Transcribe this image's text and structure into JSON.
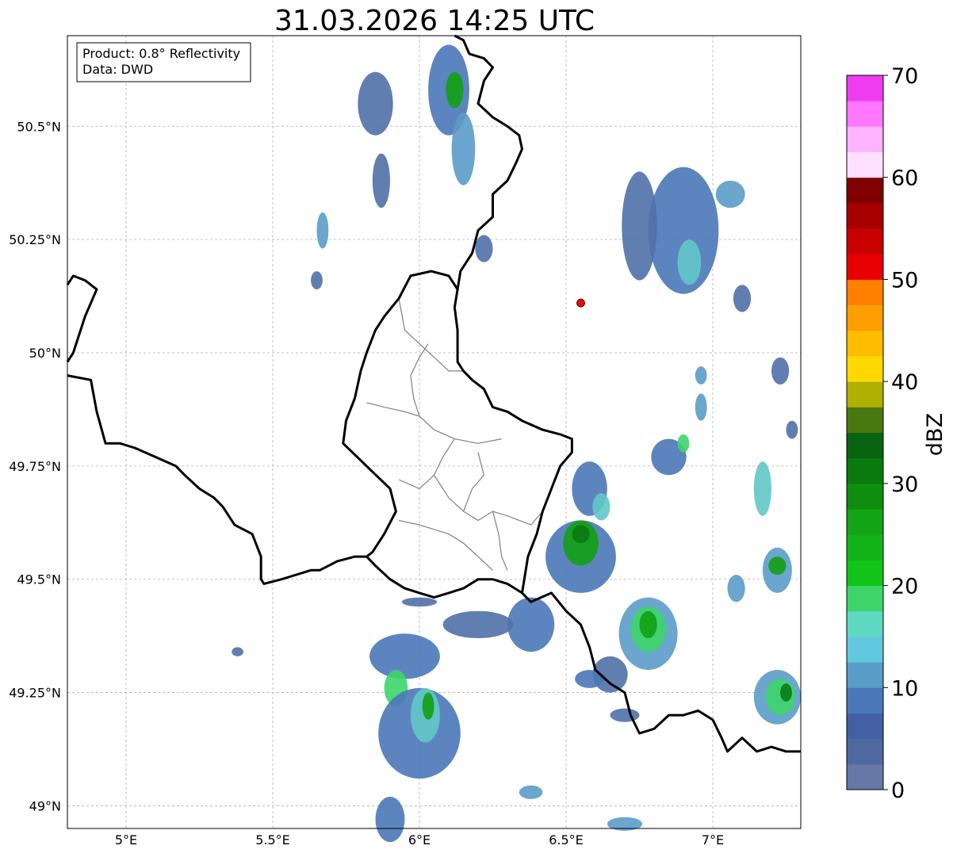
{
  "title": "31.03.2026 14:25 UTC",
  "info_box": {
    "product": "Product: 0.8° Reflectivity",
    "data": "Data: DWD"
  },
  "map": {
    "projection": "plate-carree",
    "lon_range": [
      4.8,
      7.3
    ],
    "lat_range": [
      48.95,
      50.7
    ],
    "lon_ticks": [
      {
        "value": 5.0,
        "label": "5°E"
      },
      {
        "value": 5.5,
        "label": "5.5°E"
      },
      {
        "value": 6.0,
        "label": "6°E"
      },
      {
        "value": 6.5,
        "label": "6.5°E"
      },
      {
        "value": 7.0,
        "label": "7°E"
      }
    ],
    "lat_ticks": [
      {
        "value": 50.5,
        "label": "50.5°N"
      },
      {
        "value": 50.25,
        "label": "50.25°N"
      },
      {
        "value": 50.0,
        "label": "50°N"
      },
      {
        "value": 49.75,
        "label": "49.75°N"
      },
      {
        "value": 49.5,
        "label": "49.5°N"
      },
      {
        "value": 49.25,
        "label": "49.25°N"
      },
      {
        "value": 49.0,
        "label": "49°N"
      }
    ],
    "gridlines": true,
    "radar_site": {
      "lon": 6.55,
      "lat": 50.11,
      "color": "#ff0000"
    },
    "borders": [
      [
        [
          4.8,
          50.15
        ],
        [
          4.82,
          50.17
        ],
        [
          4.86,
          50.16
        ],
        [
          4.9,
          50.14
        ],
        [
          4.86,
          50.08
        ],
        [
          4.84,
          50.04
        ],
        [
          4.82,
          50.0
        ],
        [
          4.8,
          49.98
        ]
      ],
      [
        [
          4.8,
          49.95
        ],
        [
          4.88,
          49.94
        ],
        [
          4.9,
          49.87
        ],
        [
          4.93,
          49.8
        ],
        [
          4.98,
          49.8
        ],
        [
          5.03,
          49.79
        ],
        [
          5.1,
          49.77
        ],
        [
          5.17,
          49.75
        ],
        [
          5.2,
          49.73
        ],
        [
          5.25,
          49.7
        ],
        [
          5.3,
          49.68
        ],
        [
          5.33,
          49.66
        ],
        [
          5.37,
          49.62
        ],
        [
          5.43,
          49.6
        ],
        [
          5.46,
          49.55
        ],
        [
          5.46,
          49.5
        ],
        [
          5.47,
          49.49
        ],
        [
          5.53,
          49.5
        ],
        [
          5.58,
          49.51
        ],
        [
          5.63,
          49.52
        ],
        [
          5.66,
          49.52
        ],
        [
          5.72,
          49.54
        ],
        [
          5.78,
          49.55
        ],
        [
          5.82,
          49.55
        ],
        [
          5.85,
          49.53
        ],
        [
          5.9,
          49.5
        ],
        [
          5.95,
          49.48
        ],
        [
          6.0,
          49.47
        ],
        [
          6.05,
          49.46
        ],
        [
          6.1,
          49.47
        ],
        [
          6.15,
          49.48
        ],
        [
          6.2,
          49.5
        ],
        [
          6.25,
          49.5
        ],
        [
          6.3,
          49.49
        ],
        [
          6.35,
          49.47
        ],
        [
          6.38,
          49.45
        ],
        [
          6.45,
          49.47
        ],
        [
          6.5,
          49.43
        ],
        [
          6.55,
          49.4
        ],
        [
          6.58,
          49.35
        ],
        [
          6.6,
          49.3
        ],
        [
          6.65,
          49.27
        ],
        [
          6.7,
          49.25
        ],
        [
          6.72,
          49.2
        ],
        [
          6.75,
          49.16
        ],
        [
          6.8,
          49.17
        ],
        [
          6.85,
          49.2
        ],
        [
          6.9,
          49.2
        ],
        [
          6.95,
          49.21
        ],
        [
          7.0,
          49.19
        ],
        [
          7.03,
          49.15
        ],
        [
          7.05,
          49.12
        ],
        [
          7.1,
          49.15
        ],
        [
          7.15,
          49.12
        ],
        [
          7.2,
          49.13
        ],
        [
          7.25,
          49.12
        ],
        [
          7.3,
          49.12
        ]
      ],
      [
        [
          6.35,
          49.47
        ],
        [
          6.37,
          49.55
        ],
        [
          6.4,
          49.6
        ],
        [
          6.42,
          49.65
        ],
        [
          6.45,
          49.7
        ],
        [
          6.48,
          49.75
        ],
        [
          6.52,
          49.78
        ],
        [
          6.52,
          49.81
        ],
        [
          6.48,
          49.82
        ],
        [
          6.42,
          49.83
        ],
        [
          6.35,
          49.85
        ],
        [
          6.3,
          49.87
        ],
        [
          6.25,
          49.88
        ],
        [
          6.22,
          49.92
        ],
        [
          6.18,
          49.94
        ],
        [
          6.15,
          49.96
        ],
        [
          6.13,
          49.98
        ],
        [
          6.13,
          50.05
        ],
        [
          6.12,
          50.1
        ],
        [
          6.13,
          50.14
        ],
        [
          6.14,
          50.18
        ],
        [
          6.18,
          50.22
        ],
        [
          6.2,
          50.27
        ],
        [
          6.25,
          50.3
        ],
        [
          6.25,
          50.35
        ],
        [
          6.3,
          50.38
        ],
        [
          6.33,
          50.42
        ],
        [
          6.35,
          50.45
        ],
        [
          6.34,
          50.48
        ],
        [
          6.3,
          50.5
        ],
        [
          6.25,
          50.52
        ],
        [
          6.2,
          50.55
        ],
        [
          6.22,
          50.6
        ],
        [
          6.25,
          50.63
        ],
        [
          6.22,
          50.65
        ],
        [
          6.17,
          50.66
        ],
        [
          6.15,
          50.69
        ],
        [
          6.12,
          50.7
        ]
      ],
      [
        [
          6.13,
          50.14
        ],
        [
          6.1,
          50.17
        ],
        [
          6.04,
          50.18
        ],
        [
          5.97,
          50.17
        ],
        [
          5.93,
          50.12
        ],
        [
          5.88,
          50.08
        ],
        [
          5.85,
          50.05
        ],
        [
          5.82,
          50.0
        ],
        [
          5.8,
          49.96
        ],
        [
          5.78,
          49.9
        ],
        [
          5.75,
          49.85
        ],
        [
          5.74,
          49.8
        ],
        [
          5.82,
          49.75
        ],
        [
          5.9,
          49.7
        ],
        [
          5.92,
          49.65
        ],
        [
          5.88,
          49.6
        ],
        [
          5.84,
          49.56
        ],
        [
          5.82,
          49.55
        ]
      ]
    ],
    "districts": [
      [
        [
          5.82,
          49.89
        ],
        [
          5.88,
          49.88
        ],
        [
          5.95,
          49.87
        ],
        [
          6.0,
          49.86
        ]
      ],
      [
        [
          6.0,
          49.86
        ],
        [
          6.05,
          49.83
        ],
        [
          6.12,
          49.81
        ],
        [
          6.2,
          49.8
        ],
        [
          6.28,
          49.81
        ]
      ],
      [
        [
          6.0,
          49.86
        ],
        [
          5.98,
          49.9
        ],
        [
          5.97,
          49.95
        ],
        [
          6.0,
          49.99
        ],
        [
          6.03,
          50.02
        ]
      ],
      [
        [
          5.93,
          50.12
        ],
        [
          5.95,
          50.05
        ],
        [
          6.0,
          50.02
        ],
        [
          6.05,
          49.99
        ],
        [
          6.1,
          49.96
        ],
        [
          6.15,
          49.96
        ]
      ],
      [
        [
          6.12,
          49.81
        ],
        [
          6.08,
          49.77
        ],
        [
          6.05,
          49.73
        ],
        [
          6.1,
          49.68
        ],
        [
          6.15,
          49.65
        ],
        [
          6.2,
          49.63
        ],
        [
          6.25,
          49.65
        ],
        [
          6.3,
          49.64
        ]
      ],
      [
        [
          6.3,
          49.64
        ],
        [
          6.38,
          49.62
        ],
        [
          6.42,
          49.65
        ]
      ],
      [
        [
          5.93,
          49.72
        ],
        [
          6.0,
          49.7
        ],
        [
          6.05,
          49.73
        ]
      ],
      [
        [
          5.93,
          49.63
        ],
        [
          6.0,
          49.62
        ],
        [
          6.1,
          49.6
        ],
        [
          6.15,
          49.58
        ],
        [
          6.2,
          49.55
        ],
        [
          6.25,
          49.52
        ]
      ],
      [
        [
          6.25,
          49.65
        ],
        [
          6.27,
          49.6
        ],
        [
          6.28,
          49.55
        ],
        [
          6.3,
          49.52
        ]
      ],
      [
        [
          6.2,
          49.78
        ],
        [
          6.22,
          49.73
        ],
        [
          6.18,
          49.7
        ],
        [
          6.15,
          49.65
        ]
      ]
    ],
    "echoes": [
      {
        "lon": 5.85,
        "lat": 50.55,
        "rx": 0.06,
        "ry": 0.07,
        "c": "#5070a8"
      },
      {
        "lon": 6.1,
        "lat": 50.58,
        "rx": 0.07,
        "ry": 0.1,
        "c": "#4a78b8"
      },
      {
        "lon": 6.12,
        "lat": 50.58,
        "rx": 0.03,
        "ry": 0.04,
        "c": "#12a012"
      },
      {
        "lon": 6.15,
        "lat": 50.45,
        "rx": 0.04,
        "ry": 0.08,
        "c": "#5a9cc8"
      },
      {
        "lon": 5.87,
        "lat": 50.38,
        "rx": 0.03,
        "ry": 0.06,
        "c": "#5070a8"
      },
      {
        "lon": 5.67,
        "lat": 50.27,
        "rx": 0.02,
        "ry": 0.04,
        "c": "#5a9cc8"
      },
      {
        "lon": 5.65,
        "lat": 50.16,
        "rx": 0.02,
        "ry": 0.02,
        "c": "#5070a8"
      },
      {
        "lon": 6.22,
        "lat": 50.23,
        "rx": 0.03,
        "ry": 0.03,
        "c": "#5070a8"
      },
      {
        "lon": 6.9,
        "lat": 50.27,
        "rx": 0.12,
        "ry": 0.14,
        "c": "#4a78b8"
      },
      {
        "lon": 6.92,
        "lat": 50.2,
        "rx": 0.04,
        "ry": 0.05,
        "c": "#62c8c8"
      },
      {
        "lon": 6.75,
        "lat": 50.28,
        "rx": 0.06,
        "ry": 0.12,
        "c": "#5070a8"
      },
      {
        "lon": 7.06,
        "lat": 50.35,
        "rx": 0.05,
        "ry": 0.03,
        "c": "#5a9cc8"
      },
      {
        "lon": 7.1,
        "lat": 50.12,
        "rx": 0.03,
        "ry": 0.03,
        "c": "#5070a8"
      },
      {
        "lon": 7.23,
        "lat": 49.96,
        "rx": 0.03,
        "ry": 0.03,
        "c": "#5070a8"
      },
      {
        "lon": 6.96,
        "lat": 49.95,
        "rx": 0.02,
        "ry": 0.02,
        "c": "#5a9cc8"
      },
      {
        "lon": 6.96,
        "lat": 49.88,
        "rx": 0.02,
        "ry": 0.03,
        "c": "#5a9cc8"
      },
      {
        "lon": 6.85,
        "lat": 49.77,
        "rx": 0.06,
        "ry": 0.04,
        "c": "#4a78b8"
      },
      {
        "lon": 6.9,
        "lat": 49.8,
        "rx": 0.02,
        "ry": 0.02,
        "c": "#3dd56a"
      },
      {
        "lon": 7.17,
        "lat": 49.7,
        "rx": 0.03,
        "ry": 0.06,
        "c": "#62c8c8"
      },
      {
        "lon": 6.58,
        "lat": 49.7,
        "rx": 0.06,
        "ry": 0.06,
        "c": "#4a78b8"
      },
      {
        "lon": 6.62,
        "lat": 49.66,
        "rx": 0.03,
        "ry": 0.03,
        "c": "#62c8c8"
      },
      {
        "lon": 6.55,
        "lat": 49.55,
        "rx": 0.12,
        "ry": 0.08,
        "c": "#4a78b8"
      },
      {
        "lon": 6.55,
        "lat": 49.58,
        "rx": 0.06,
        "ry": 0.05,
        "c": "#12a012"
      },
      {
        "lon": 6.55,
        "lat": 49.6,
        "rx": 0.03,
        "ry": 0.02,
        "c": "#0a7a14"
      },
      {
        "lon": 7.22,
        "lat": 49.52,
        "rx": 0.05,
        "ry": 0.05,
        "c": "#5a9cc8"
      },
      {
        "lon": 7.22,
        "lat": 49.53,
        "rx": 0.03,
        "ry": 0.02,
        "c": "#12a012"
      },
      {
        "lon": 7.08,
        "lat": 49.48,
        "rx": 0.03,
        "ry": 0.03,
        "c": "#5a9cc8"
      },
      {
        "lon": 6.78,
        "lat": 49.38,
        "rx": 0.1,
        "ry": 0.08,
        "c": "#5a9cc8"
      },
      {
        "lon": 6.78,
        "lat": 49.39,
        "rx": 0.06,
        "ry": 0.05,
        "c": "#3dd56a"
      },
      {
        "lon": 6.78,
        "lat": 49.4,
        "rx": 0.03,
        "ry": 0.03,
        "c": "#12a012"
      },
      {
        "lon": 6.38,
        "lat": 49.4,
        "rx": 0.08,
        "ry": 0.06,
        "c": "#4a78b8"
      },
      {
        "lon": 6.65,
        "lat": 49.29,
        "rx": 0.06,
        "ry": 0.04,
        "c": "#5070a8"
      },
      {
        "lon": 6.2,
        "lat": 49.4,
        "rx": 0.12,
        "ry": 0.03,
        "c": "#5070a8"
      },
      {
        "lon": 5.95,
        "lat": 49.33,
        "rx": 0.12,
        "ry": 0.05,
        "c": "#4a78b8"
      },
      {
        "lon": 5.92,
        "lat": 49.26,
        "rx": 0.04,
        "ry": 0.04,
        "c": "#3dd56a"
      },
      {
        "lon": 6.0,
        "lat": 49.16,
        "rx": 0.14,
        "ry": 0.1,
        "c": "#4a78b8"
      },
      {
        "lon": 6.02,
        "lat": 49.2,
        "rx": 0.05,
        "ry": 0.06,
        "c": "#62c8c8"
      },
      {
        "lon": 6.03,
        "lat": 49.22,
        "rx": 0.02,
        "ry": 0.03,
        "c": "#12a012"
      },
      {
        "lon": 7.22,
        "lat": 49.24,
        "rx": 0.08,
        "ry": 0.06,
        "c": "#5a9cc8"
      },
      {
        "lon": 7.23,
        "lat": 49.24,
        "rx": 0.05,
        "ry": 0.04,
        "c": "#3dd56a"
      },
      {
        "lon": 7.25,
        "lat": 49.25,
        "rx": 0.02,
        "ry": 0.02,
        "c": "#0a7a14"
      },
      {
        "lon": 6.7,
        "lat": 49.2,
        "rx": 0.05,
        "ry": 0.015,
        "c": "#5070a8"
      },
      {
        "lon": 6.58,
        "lat": 49.28,
        "rx": 0.05,
        "ry": 0.02,
        "c": "#4a78b8"
      },
      {
        "lon": 5.9,
        "lat": 48.97,
        "rx": 0.05,
        "ry": 0.05,
        "c": "#4a78b8"
      },
      {
        "lon": 6.38,
        "lat": 49.03,
        "rx": 0.04,
        "ry": 0.015,
        "c": "#5a9cc8"
      },
      {
        "lon": 6.7,
        "lat": 48.96,
        "rx": 0.06,
        "ry": 0.015,
        "c": "#5a9cc8"
      },
      {
        "lon": 5.38,
        "lat": 49.34,
        "rx": 0.02,
        "ry": 0.01,
        "c": "#5070a8"
      },
      {
        "lon": 6.0,
        "lat": 49.45,
        "rx": 0.06,
        "ry": 0.01,
        "c": "#5070a8"
      },
      {
        "lon": 7.27,
        "lat": 49.83,
        "rx": 0.02,
        "ry": 0.02,
        "c": "#5070a8"
      }
    ]
  },
  "colorbar": {
    "label": "dBZ",
    "vmin": 0,
    "vmax": 70,
    "tick_labels": [
      "0",
      "10",
      "20",
      "30",
      "40",
      "50",
      "60",
      "70"
    ],
    "colors": [
      "#6678a8",
      "#5068a0",
      "#4460a4",
      "#4a78b8",
      "#5a9cc8",
      "#62c8e0",
      "#5ed8c0",
      "#3dd56a",
      "#12c418",
      "#12b41a",
      "#12a414",
      "#0e8e0e",
      "#0a7a0e",
      "#086410",
      "#4a7810",
      "#b0b000",
      "#ffd800",
      "#ffbc00",
      "#ff9e00",
      "#ff8000",
      "#e80000",
      "#c80000",
      "#a80000",
      "#800000",
      "#ffe0ff",
      "#ffb4ff",
      "#ff78ff",
      "#f03cf0"
    ]
  }
}
